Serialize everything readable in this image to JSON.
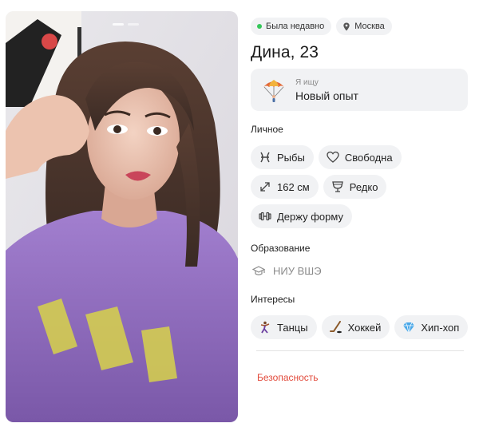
{
  "profile": {
    "status": {
      "text": "Была недавно",
      "color": "#34c759"
    },
    "location": "Москва",
    "name_age": "Дина, 23",
    "looking_for": {
      "label": "Я ищу",
      "value": "Новый опыт",
      "icon": "parachute-icon"
    },
    "photo": {
      "description": "selfie-photo",
      "indicators": 2
    }
  },
  "sections": {
    "personal": {
      "title": "Личное",
      "chips": [
        {
          "icon": "pisces-icon",
          "label": "Рыбы"
        },
        {
          "icon": "heart-icon",
          "label": "Свободна"
        },
        {
          "icon": "height-icon",
          "label": "162 см"
        },
        {
          "icon": "drink-icon",
          "label": "Редко"
        },
        {
          "icon": "dumbbell-icon",
          "label": "Держу форму"
        }
      ]
    },
    "education": {
      "title": "Образование",
      "value": "НИУ ВШЭ",
      "icon": "graduation-cap-icon"
    },
    "interests": {
      "title": "Интересы",
      "chips": [
        {
          "icon": "dancer-icon",
          "label": "Танцы"
        },
        {
          "icon": "hockey-icon",
          "label": "Хоккей"
        },
        {
          "icon": "diamond-icon",
          "label": "Хип-хоп"
        }
      ]
    }
  },
  "footer": {
    "safety_link": "Безопасность",
    "safety_color": "#e24a3b"
  }
}
